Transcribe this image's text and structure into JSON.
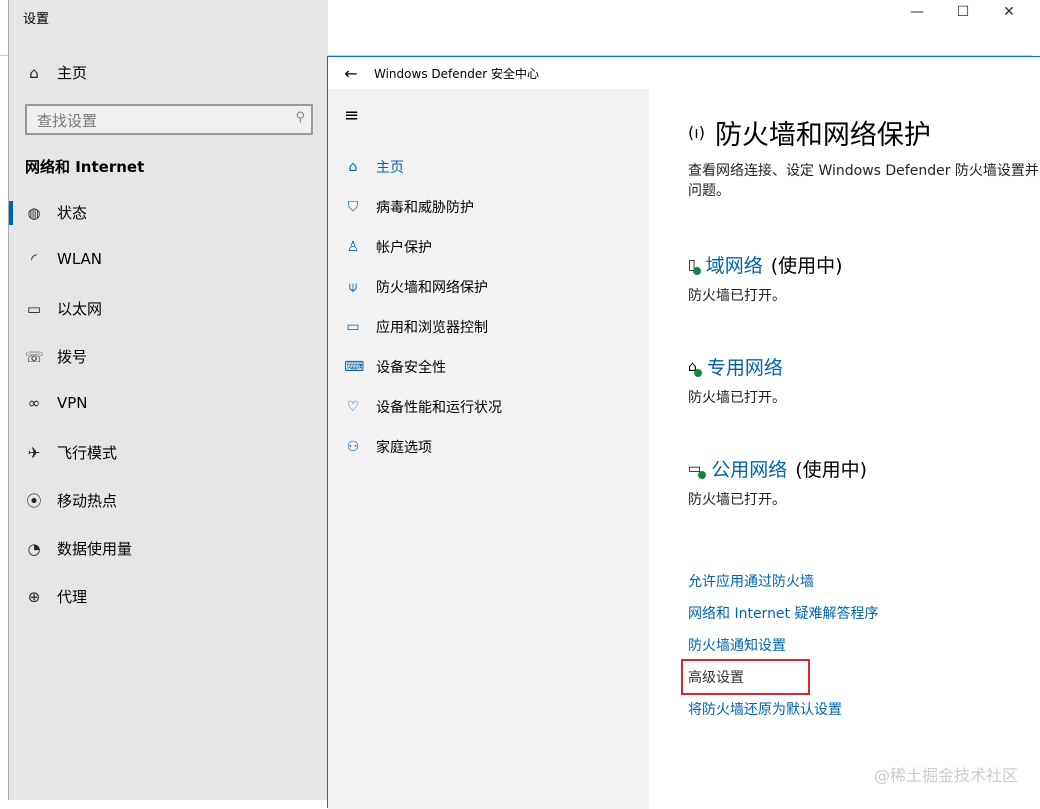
{
  "settings": {
    "title": "设置",
    "home": "主页",
    "search_placeholder": "查找设置",
    "section": "网络和 Internet",
    "items": [
      {
        "label": "状态",
        "icon": "globe-status-icon"
      },
      {
        "label": "WLAN",
        "icon": "wifi-icon"
      },
      {
        "label": "以太网",
        "icon": "ethernet-icon"
      },
      {
        "label": "拨号",
        "icon": "dialup-icon"
      },
      {
        "label": "VPN",
        "icon": "vpn-icon"
      },
      {
        "label": "飞行模式",
        "icon": "airplane-icon"
      },
      {
        "label": "移动热点",
        "icon": "hotspot-icon"
      },
      {
        "label": "数据使用量",
        "icon": "data-usage-icon"
      },
      {
        "label": "代理",
        "icon": "globe-icon"
      }
    ]
  },
  "defender": {
    "title": "Windows Defender 安全中心",
    "nav": [
      {
        "label": "主页"
      },
      {
        "label": "病毒和威胁防护"
      },
      {
        "label": "帐户保护"
      },
      {
        "label": "防火墙和网络保护"
      },
      {
        "label": "应用和浏览器控制"
      },
      {
        "label": "设备安全性"
      },
      {
        "label": "设备性能和运行状况"
      },
      {
        "label": "家庭选项"
      }
    ],
    "heading": "防火墙和网络保护",
    "desc1": "查看网络连接、设定 Windows Defender 防火墙设置并",
    "desc2": "问题。",
    "networks": [
      {
        "name": "域网络",
        "state": "(使用中)",
        "status": "防火墙已打开。"
      },
      {
        "name": "专用网络",
        "state": "",
        "status": "防火墙已打开。"
      },
      {
        "name": "公用网络",
        "state": "(使用中)",
        "status": "防火墙已打开。"
      }
    ],
    "links": [
      "允许应用通过防火墙",
      "网络和 Internet 疑难解答程序",
      "防火墙通知设置",
      "高级设置",
      "将防火墙还原为默认设置"
    ]
  },
  "watermark": "@稀土掘金技术社区"
}
